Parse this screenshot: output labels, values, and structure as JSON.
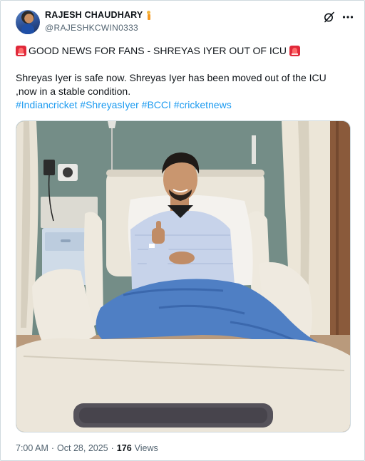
{
  "author": {
    "display_name": "RAJESH CHAUDHARY",
    "handle": "@RAJESHKCWIN0333",
    "name_emoji": "person-standing-icon"
  },
  "header_actions": {
    "grok_icon": "grok-slash-icon",
    "more_icon": "more-dots-icon"
  },
  "tweet": {
    "headline": "GOOD NEWS FOR FANS - SHREYAS IYER OUT OF ICU",
    "body_line1": "Shreyas Iyer is safe now. Shreyas Iyer has been moved out of the ICU",
    "body_line2": ",now in a stable condition.",
    "hashtags": [
      "#Indiancricket",
      "#ShreyasIyer",
      "#BCCI",
      "#cricketnews"
    ]
  },
  "media": {
    "type": "photo"
  },
  "meta": {
    "time": "7:00 AM",
    "separator": "·",
    "date": "Oct 28, 2025",
    "views_count": "176",
    "views_label": "Views"
  },
  "colors": {
    "link": "#1d9bf0",
    "text": "#0f1419",
    "secondary": "#536471",
    "siren": "#e0293a"
  }
}
